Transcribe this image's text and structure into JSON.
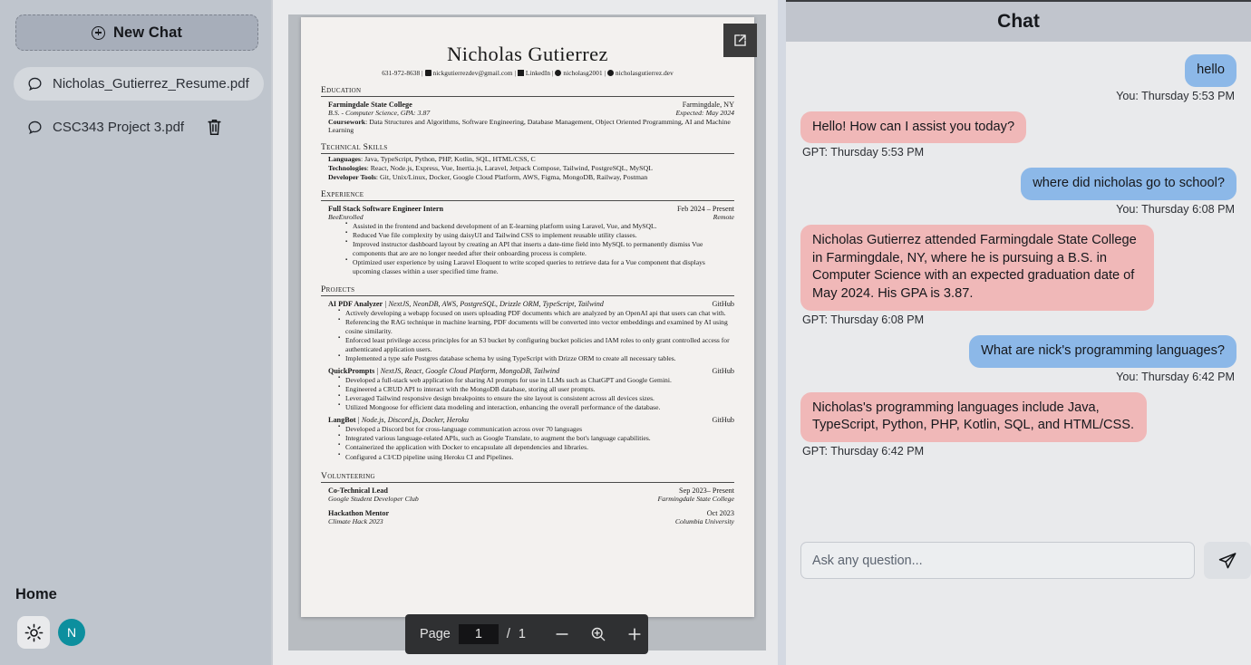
{
  "sidebar": {
    "new_chat_label": "New Chat",
    "new_chat_icon": "plus-circle-icon",
    "chats": [
      {
        "name": "Nicholas_Gutierrez_Resume.pdf",
        "active": true
      },
      {
        "name": "CSC343 Project 3.pdf",
        "active": false
      }
    ],
    "home_label": "Home",
    "theme_icon": "sun-icon",
    "avatar_initial": "N",
    "avatar_color": "#0d8f9e"
  },
  "viewer": {
    "expand_icon": "external-link-icon",
    "toolbar": {
      "page_label": "Page",
      "page_value": "1",
      "separator": "/",
      "total_pages": "1",
      "zoom_out_icon": "minus-icon",
      "zoom_icon": "magnifier-plus-icon",
      "zoom_in_icon": "plus-icon"
    }
  },
  "resume": {
    "name": "Nicholas Gutierrez",
    "contact": {
      "phone": "631-972-8638",
      "email": "nickgutierrezdev@gmail.com",
      "linkedin": "LinkedIn",
      "github": "nicholasg2001",
      "website": "nicholasgutierrez.dev"
    },
    "sections": {
      "education_title": "Education",
      "skills_title": "Technical Skills",
      "experience_title": "Experience",
      "projects_title": "Projects",
      "volunteering_title": "Volunteering"
    },
    "education": {
      "school": "Farmingdale State College",
      "location": "Farmingdale, NY",
      "degree": "B.S. - Computer Science, GPA: 3.87",
      "expected": "Expected: May 2024",
      "coursework_label": "Coursework",
      "coursework": ": Data Structures and Algorithms, Software Engineering, Database Management, Object Oriented Programming, AI and Machine Learning"
    },
    "skills": [
      {
        "label": "Languages",
        "value": ": Java, TypeScript, Python, PHP, Kotlin, SQL, HTML/CSS, C"
      },
      {
        "label": "Technologies",
        "value": ": React, Node.js, Express, Vue, Inertia.js, Laravel, Jetpack Compose, Tailwind, PostgreSQL, MySQL"
      },
      {
        "label": "Developer Tools",
        "value": ": Git, Unix/Linux, Docker, Google Cloud Platform, AWS, Figma, MongoDB, Railway, Postman"
      }
    ],
    "experience": [
      {
        "title": "Full Stack Software Engineer Intern",
        "dates": "Feb 2024 – Present",
        "company": "BeeEnrolled",
        "location": "Remote",
        "bullets": [
          "Assisted in the frontend and backend development of an E-learning platform using Laravel, Vue, and MySQL.",
          "Reduced Vue file complexity by using daisyUI and Tailwind CSS to implement reusable utility classes.",
          "Improved instructor dashboard layout by creating an API that inserts a date-time field into MySQL to permanently dismiss Vue components that are are no longer needed after their onboarding process is complete.",
          "Optimized user experience by using Laravel Eloquent to write scoped queries to retrieve data for a Vue component that displays upcoming classes within a user specified time frame."
        ]
      }
    ],
    "projects": [
      {
        "name": "AI PDF Analyzer",
        "tech": "| NextJS, NeonDB, AWS, PostgreSQL, Drizzle ORM, TypeScript, Tailwind",
        "link": "GitHub",
        "bullets": [
          "Actively developing a webapp focused on users uploading PDF documents which are analyzed by an OpenAI api that users can chat with.",
          "Referencing the RAG technique in machine learning, PDF documents will be converted into vector embeddings and examined by AI using cosine similarity.",
          "Enforced least privilege access principles for an S3 bucket by configuring bucket policies and IAM roles to only grant controlled access for authenticated application users.",
          "Implemented a type safe Postgres database schema by using TypeScript with Drizze ORM to create all necessary tables."
        ]
      },
      {
        "name": "QuickPrompts",
        "tech": "| NextJS, React, Google Cloud Platform, MongoDB, Tailwind",
        "link": "GitHub",
        "bullets": [
          "Developed a full-stack web application for sharing AI prompts for use in LLMs such as ChatGPT and Google Gemini.",
          "Engineered a CRUD API to interact with the MongoDB database, storing all user prompts.",
          "Leveraged Tailwind responsive design breakpoints to ensure the site layout is consistent across all devices sizes.",
          "Utilized Mongoose for efficient data modeling and interaction, enhancing the overall performance of the database."
        ]
      },
      {
        "name": "LangBot",
        "tech": "| Node.js, Discord.js, Docker, Heroku",
        "link": "GitHub",
        "bullets": [
          "Developed a Discord bot for cross-language communication across over 70 languages",
          "Integrated various language-related APIs, such as Google Translate, to augment the bot's language capabilities.",
          "Containerized the application with Docker to encapsulate all dependencies and libraries.",
          "Configured a CI/CD pipeline using Heroku CI and Pipelines."
        ]
      }
    ],
    "volunteering": [
      {
        "title": "Co-Technical Lead",
        "dates": "Sep 2023– Present",
        "org": "Google Student Developer Club",
        "place": "Farmingdale State College"
      },
      {
        "title": "Hackathon Mentor",
        "dates": "Oct 2023",
        "org": "Climate Hack 2023",
        "place": "Columbia University"
      }
    ]
  },
  "chat": {
    "title": "Chat",
    "messages": [
      {
        "role": "you",
        "text": "hello",
        "meta": "You: Thursday 5:53 PM"
      },
      {
        "role": "gpt",
        "text": "Hello! How can I assist you today?",
        "meta": "GPT: Thursday 5:53 PM"
      },
      {
        "role": "you",
        "text": "where did nicholas go to school?",
        "meta": "You: Thursday 6:08 PM"
      },
      {
        "role": "gpt",
        "text": "Nicholas Gutierrez attended Farmingdale State College in Farmingdale, NY, where he is pursuing a B.S. in Computer Science with an expected graduation date of May 2024. His GPA is 3.87.",
        "meta": "GPT: Thursday 6:08 PM"
      },
      {
        "role": "you",
        "text": "What are nick's programming languages?",
        "meta": "You: Thursday 6:42 PM"
      },
      {
        "role": "gpt",
        "text": "Nicholas's programming languages include Java, TypeScript, Python, PHP, Kotlin, SQL, and HTML/CSS.",
        "meta": "GPT: Thursday 6:42 PM"
      }
    ],
    "input_placeholder": "Ask any question...",
    "input_value": "",
    "send_icon": "send-paper-plane-icon"
  },
  "colors": {
    "user_bubble": "#8cb8e8",
    "gpt_bubble": "#f0b8b8",
    "sidebar_bg": "#bfc5cd",
    "avatar": "#0d8f9e"
  }
}
